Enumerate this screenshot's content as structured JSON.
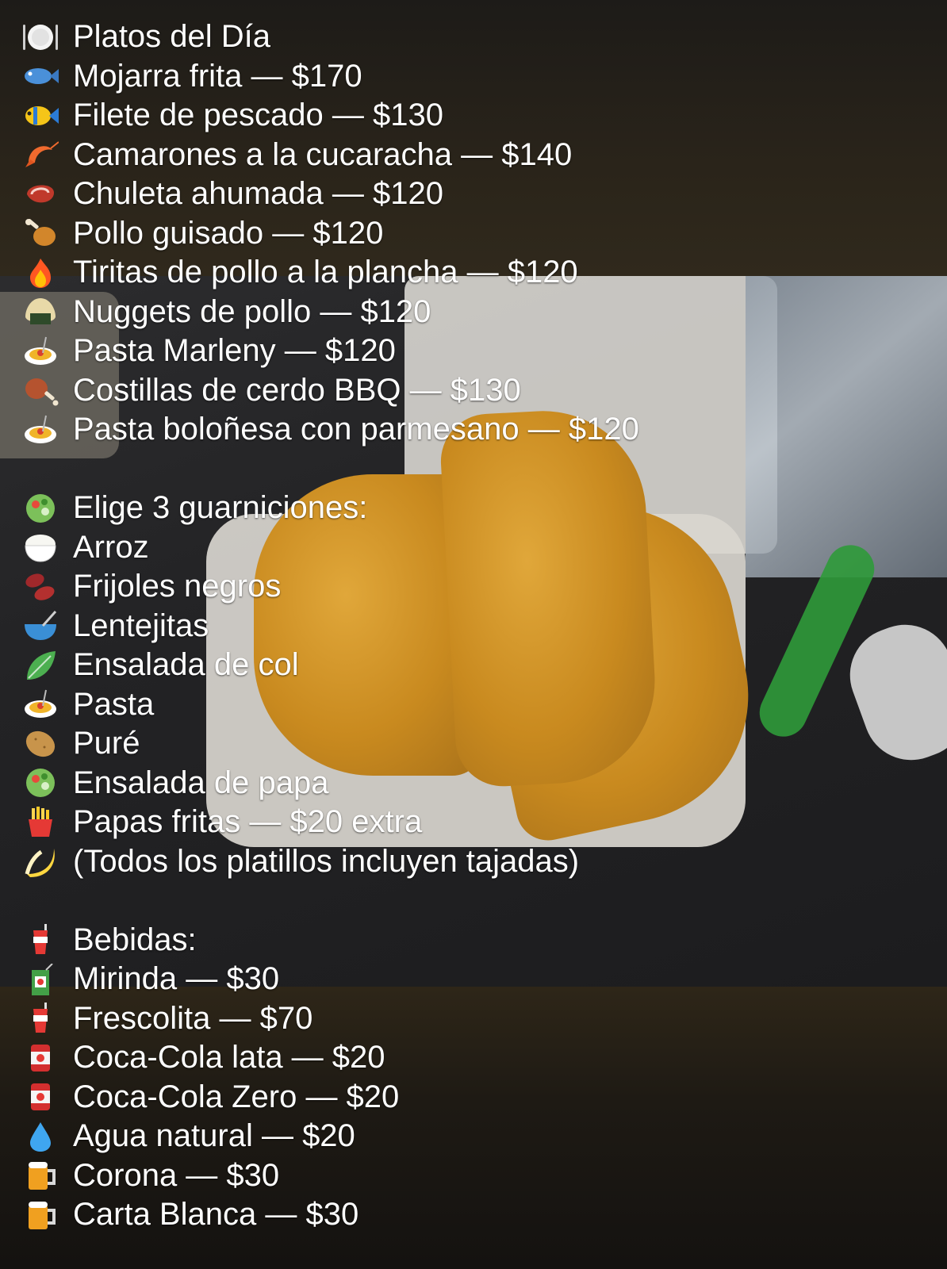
{
  "menu": {
    "dishes_title": "Platos del Día",
    "dishes": [
      {
        "icon": "fish-icon",
        "text": "Mojarra frita — $170"
      },
      {
        "icon": "tropical-fish-icon",
        "text": "Filete de pescado — $130"
      },
      {
        "icon": "shrimp-icon",
        "text": "Camarones a la cucaracha — $140"
      },
      {
        "icon": "steak-icon",
        "text": "Chuleta ahumada — $120"
      },
      {
        "icon": "poultry-leg-icon",
        "text": "Pollo guisado — $120"
      },
      {
        "icon": "fire-icon",
        "text": "Tiritas de pollo a la plancha — $120"
      },
      {
        "icon": "rice-ball-icon",
        "text": "Nuggets de pollo — $120"
      },
      {
        "icon": "spaghetti-icon",
        "text": "Pasta Marleny — $120"
      },
      {
        "icon": "meat-on-bone-icon",
        "text": "Costillas de cerdo BBQ — $130"
      },
      {
        "icon": "spaghetti-icon",
        "text": "Pasta boloñesa con parmesano — $120"
      }
    ],
    "sides_title": "Elige 3 guarniciones:",
    "sides": [
      {
        "icon": "rice-icon",
        "text": "Arroz"
      },
      {
        "icon": "beans-icon",
        "text": "Frijoles negros"
      },
      {
        "icon": "bowl-with-spoon-icon",
        "text": "Lentejitas"
      },
      {
        "icon": "leafy-green-icon",
        "text": "Ensalada de col"
      },
      {
        "icon": "spaghetti-icon",
        "text": "Pasta"
      },
      {
        "icon": "potato-icon",
        "text": "Puré"
      },
      {
        "icon": "salad-icon",
        "text": "Ensalada de papa"
      },
      {
        "icon": "french-fries-icon",
        "text": "Papas fritas — $20 extra"
      },
      {
        "icon": "banana-icon",
        "text": "(Todos los platillos incluyen tajadas)"
      }
    ],
    "drinks_title": "Bebidas:",
    "drinks": [
      {
        "icon": "juice-box-icon",
        "text": "Mirinda — $30"
      },
      {
        "icon": "cup-with-straw-icon",
        "text": "Frescolita — $70"
      },
      {
        "icon": "canned-food-icon",
        "text": "Coca-Cola lata — $20"
      },
      {
        "icon": "canned-food-icon",
        "text": "Coca-Cola Zero — $20"
      },
      {
        "icon": "droplet-icon",
        "text": "Agua natural — $20"
      },
      {
        "icon": "beer-mug-icon",
        "text": "Corona — $30"
      },
      {
        "icon": "beer-mug-icon",
        "text": "Carta Blanca — $30"
      }
    ]
  }
}
